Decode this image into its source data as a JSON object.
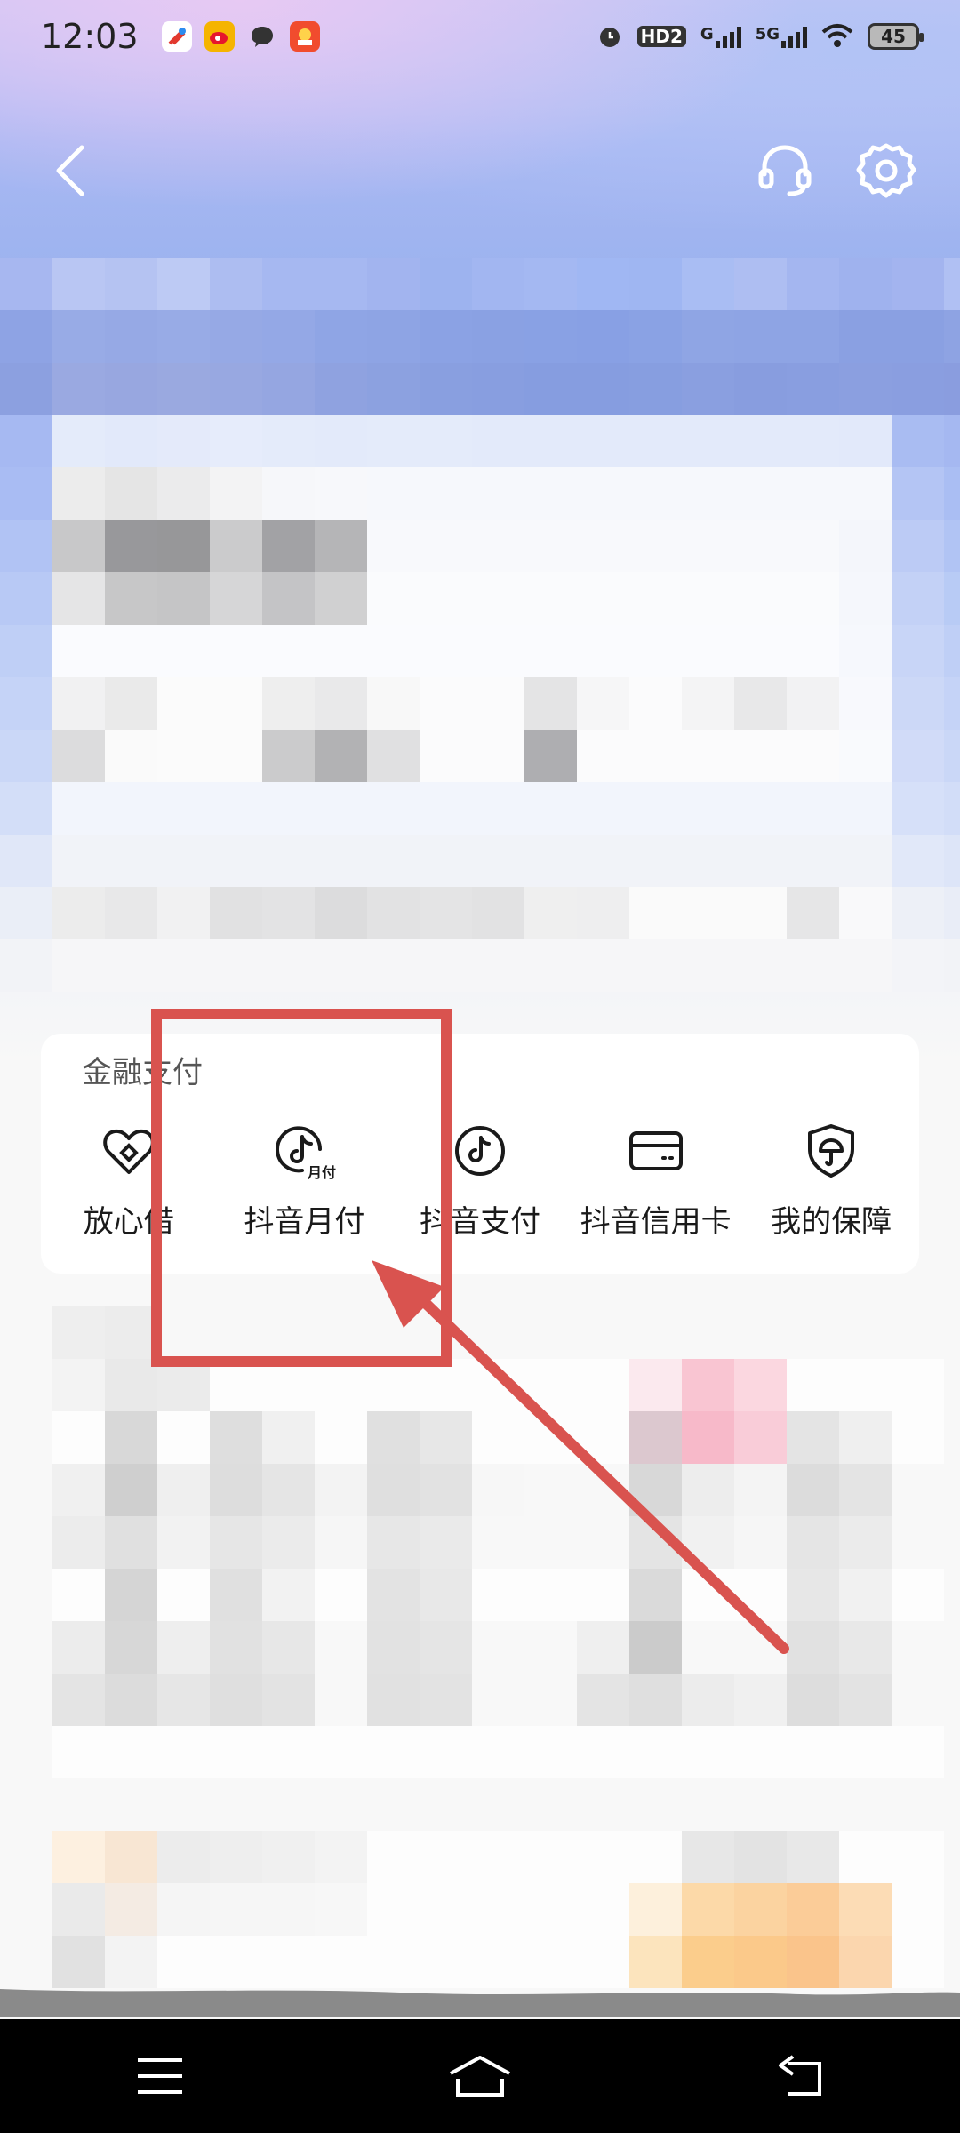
{
  "status_bar": {
    "time": "12:03",
    "network_label": "HD2",
    "signal1_label": "G",
    "signal2_label": "5G",
    "battery": "45"
  },
  "finance": {
    "title": "金融支付",
    "items": [
      {
        "label": "放心借",
        "icon": "heart-coin-icon"
      },
      {
        "label": "抖音月付",
        "icon": "douyin-monthly-pay-icon",
        "badge": "月付"
      },
      {
        "label": "抖音支付",
        "icon": "douyin-pay-icon"
      },
      {
        "label": "抖音信用卡",
        "icon": "credit-card-icon"
      },
      {
        "label": "我的保障",
        "icon": "shield-umbrella-icon"
      }
    ]
  },
  "colors": {
    "annotation_red": "#d9534f",
    "text_primary": "#1a1a1a",
    "card_bg": "#ffffff"
  }
}
